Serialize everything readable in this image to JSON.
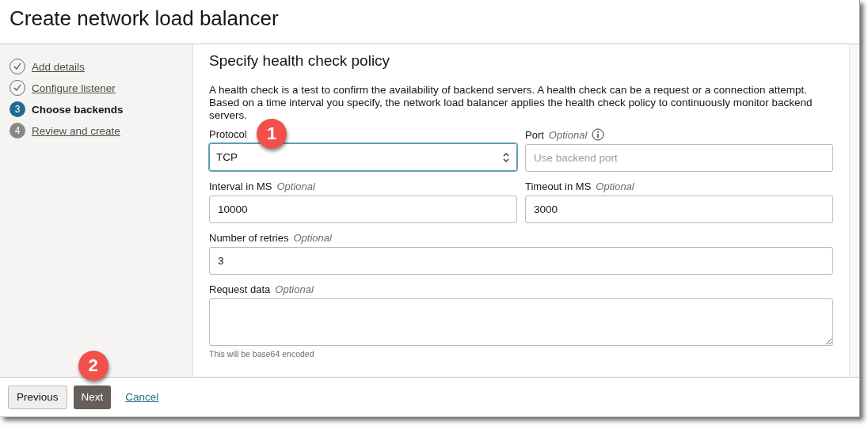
{
  "window": {
    "title": "Create network load balancer"
  },
  "steps": [
    {
      "label": "Add details",
      "completed": true,
      "selected": false
    },
    {
      "label": "Configure listener",
      "completed": true,
      "selected": false
    },
    {
      "label": "Choose backends",
      "number": "3",
      "completed": false,
      "selected": true
    },
    {
      "label": "Review and create",
      "number": "4",
      "completed": false,
      "selected": false
    }
  ],
  "section": {
    "title": "Specify health check policy",
    "description": "A health check is a test to confirm the availability of backend servers. A health check can be a request or a connection attempt. Based on a time interval you specify, the network load balancer applies the health check policy to continuously monitor backend servers."
  },
  "fields": [
    {
      "kind": "select",
      "label": "Protocol",
      "value": "TCP",
      "focused": true,
      "callout": "1"
    },
    {
      "kind": "input",
      "label": "Port",
      "optional": "Optional",
      "placeholder": "Use backend port",
      "info": true
    },
    {
      "kind": "input",
      "label": "Interval in MS",
      "optional": "Optional",
      "value": "10000"
    },
    {
      "kind": "input",
      "label": "Timeout in MS",
      "optional": "Optional",
      "value": "3000"
    },
    {
      "kind": "input",
      "label": "Number of retries",
      "optional": "Optional",
      "value": "3",
      "wide": true
    },
    {
      "kind": "textarea",
      "label": "Request data",
      "optional": "Optional",
      "hint": "This will be base64 encoded",
      "wide": true
    }
  ],
  "footer": {
    "buttons": [
      {
        "label": "Previous",
        "kind": "secondary"
      },
      {
        "label": "Next",
        "kind": "primary",
        "callout": "2"
      },
      {
        "label": "Cancel",
        "kind": "link"
      }
    ]
  }
}
